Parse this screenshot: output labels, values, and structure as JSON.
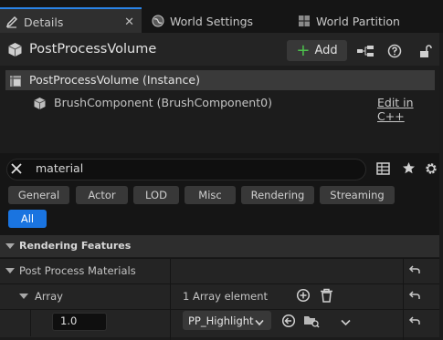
{
  "tabs": [
    {
      "label": "Details",
      "icon": "pencil-icon",
      "active": true
    },
    {
      "label": "World Settings",
      "icon": "globe-icon",
      "active": false
    },
    {
      "label": "World Partition",
      "icon": "grid-icon",
      "active": false
    }
  ],
  "tab_close": "✕",
  "header": {
    "title": "PostProcessVolume",
    "add_label": "Add"
  },
  "components": {
    "root": "PostProcessVolume (Instance)",
    "child": "BrushComponent (BrushComponent0)",
    "edit_link": "Edit in C++"
  },
  "search": {
    "value": "material"
  },
  "filters": [
    "General",
    "Actor",
    "LOD",
    "Misc",
    "Rendering",
    "Streaming",
    "All"
  ],
  "selected_filter": "All",
  "properties": {
    "category": "Rendering Features",
    "pp_materials": "Post Process Materials",
    "array_label": "Array",
    "array_summary": "1 Array element",
    "element_weight": "1.0",
    "element_material": "PP_Highlight"
  },
  "colors": {
    "accent": "#1a74e0",
    "add_plus": "#4cc24c",
    "active_tab_line": "#2a83e6"
  }
}
